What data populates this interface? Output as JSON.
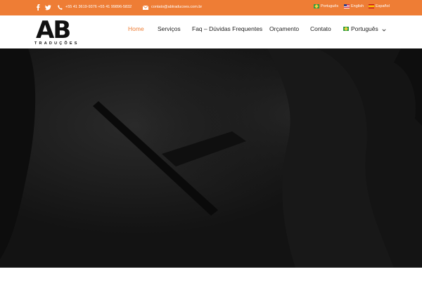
{
  "topbar": {
    "phone": "+55 41  3619-9376  +55 41  99896-5832",
    "email": "contato@abtraducoes.com.br",
    "languages": [
      {
        "label": "Português"
      },
      {
        "label": "English"
      },
      {
        "label": "Español"
      }
    ],
    "color": "#ee7d35"
  },
  "logo": {
    "main": "AB",
    "sub": "TRADUÇÕES"
  },
  "nav": {
    "items": [
      {
        "label": "Home"
      },
      {
        "label": "Serviços"
      },
      {
        "label": "Faq – Dúvidas Frequentes"
      },
      {
        "label": "Orçamento"
      },
      {
        "label": "Contato"
      }
    ],
    "language": "Português",
    "active_color": "#ee7d35"
  },
  "icons": {
    "facebook": "facebook-icon",
    "twitter": "twitter-icon",
    "phone": "phone-icon",
    "mail": "mail-icon",
    "dropdown": "chevron-down-icon"
  }
}
